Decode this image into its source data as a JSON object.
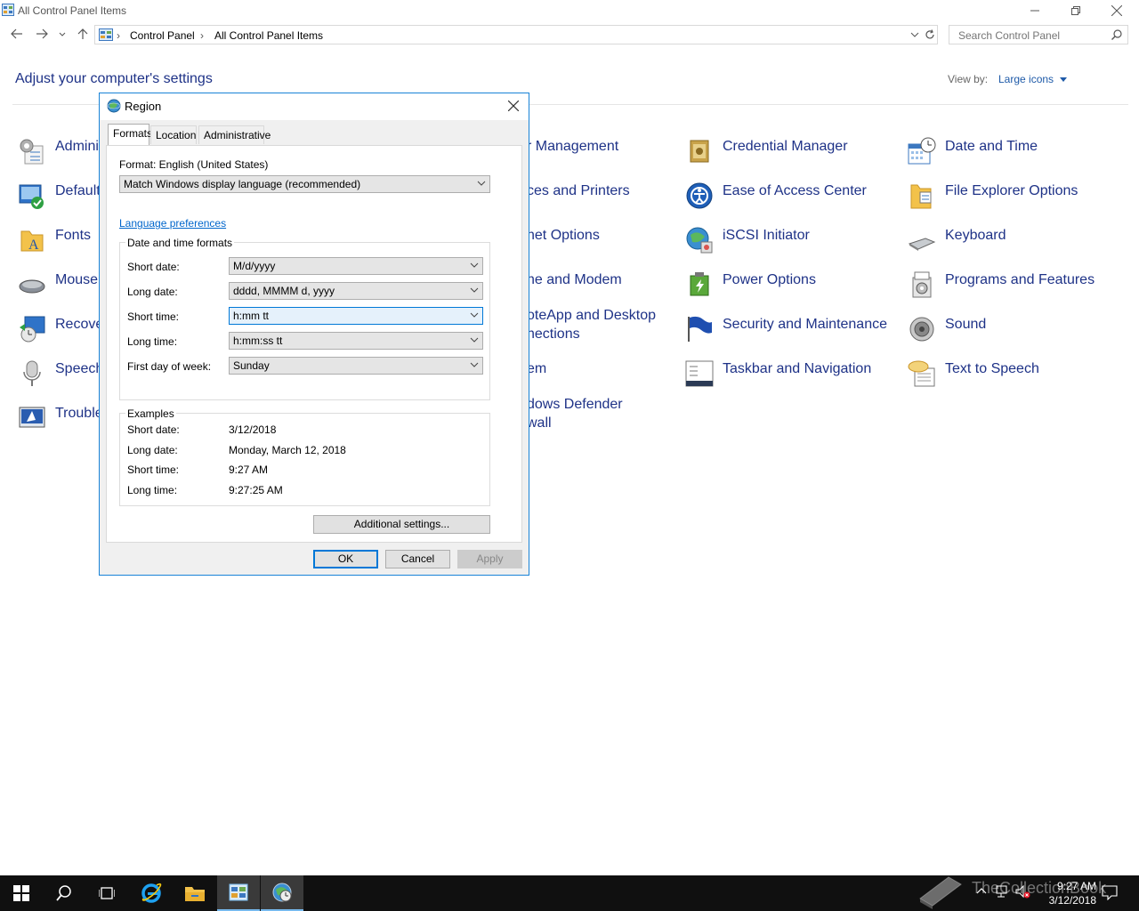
{
  "window": {
    "title": "All Control Panel Items",
    "minimize": "—",
    "restore": "❐",
    "close": "✕"
  },
  "address": {
    "crumbs": [
      "Control Panel",
      "All Control Panel Items"
    ],
    "search_placeholder": "Search Control Panel"
  },
  "control_panel": {
    "heading": "Adjust your computer's settings",
    "view_by_label": "View by:",
    "view_by_value": "Large icons",
    "items": [
      {
        "label": "Admini",
        "icon": "administrative-tools-icon"
      },
      {
        "label": "Default",
        "icon": "default-programs-icon"
      },
      {
        "label": "Fonts",
        "icon": "fonts-icon"
      },
      {
        "label": "Mouse",
        "icon": "mouse-icon"
      },
      {
        "label": "Recove",
        "icon": "recovery-icon"
      },
      {
        "label": "Speech",
        "icon": "speech-recognition-icon"
      },
      {
        "label": "Trouble",
        "icon": "troubleshooting-icon"
      },
      {
        "label": "r Management",
        "icon": ""
      },
      {
        "label": "ces and Printers",
        "icon": ""
      },
      {
        "label": "net Options",
        "icon": ""
      },
      {
        "label": "ne and Modem",
        "icon": ""
      },
      {
        "label": "oteApp and Desktop",
        "icon": ""
      },
      {
        "label": "nections",
        "icon": ""
      },
      {
        "label": "em",
        "icon": ""
      },
      {
        "label": "dows Defender",
        "icon": ""
      },
      {
        "label": "wall",
        "icon": ""
      },
      {
        "label": "Credential Manager",
        "icon": "credential-manager-icon"
      },
      {
        "label": "Ease of Access Center",
        "icon": "ease-of-access-icon"
      },
      {
        "label": "iSCSI Initiator",
        "icon": "iscsi-initiator-icon"
      },
      {
        "label": "Power Options",
        "icon": "power-options-icon"
      },
      {
        "label": "Security and Maintenance",
        "icon": "security-maintenance-icon"
      },
      {
        "label": "Taskbar and Navigation",
        "icon": "taskbar-navigation-icon"
      },
      {
        "label": "Date and Time",
        "icon": "date-time-icon"
      },
      {
        "label": "File Explorer Options",
        "icon": "file-explorer-options-icon"
      },
      {
        "label": "Keyboard",
        "icon": "keyboard-icon"
      },
      {
        "label": "Programs and Features",
        "icon": "programs-features-icon"
      },
      {
        "label": "Sound",
        "icon": "sound-icon"
      },
      {
        "label": "Text to Speech",
        "icon": "text-to-speech-icon"
      }
    ]
  },
  "dialog": {
    "title": "Region",
    "tabs": [
      "Formats",
      "Location",
      "Administrative"
    ],
    "active_tab": "Formats",
    "format_label": "Format: English (United States)",
    "format_value": "Match Windows display language (recommended)",
    "language_link": "Language preferences",
    "datetime_group": "Date and time formats",
    "fields": [
      {
        "label": "Short date:",
        "value": "M/d/yyyy"
      },
      {
        "label": "Long date:",
        "value": "dddd, MMMM d, yyyy"
      },
      {
        "label": "Short time:",
        "value": "h:mm tt"
      },
      {
        "label": "Long time:",
        "value": "h:mm:ss tt"
      },
      {
        "label": "First day of week:",
        "value": "Sunday"
      }
    ],
    "examples_group": "Examples",
    "examples": [
      {
        "label": "Short date:",
        "value": "3/12/2018"
      },
      {
        "label": "Long date:",
        "value": "Monday, March 12, 2018"
      },
      {
        "label": "Short time:",
        "value": "9:27 AM"
      },
      {
        "label": "Long time:",
        "value": "9:27:25 AM"
      }
    ],
    "additional_settings": "Additional settings...",
    "ok": "OK",
    "cancel": "Cancel",
    "apply": "Apply"
  },
  "taskbar": {
    "time": "9:27 AM",
    "date": "3/12/2018",
    "watermark": "TheCollectionBook"
  },
  "colors": {
    "link": "#1e3287",
    "accent": "#0078d7",
    "taskbar": "#101010"
  }
}
